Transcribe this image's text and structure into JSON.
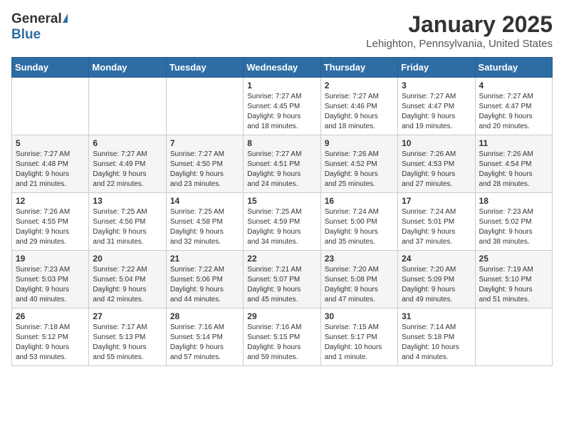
{
  "header": {
    "logo_general": "General",
    "logo_blue": "Blue",
    "month_title": "January 2025",
    "location": "Lehighton, Pennsylvania, United States"
  },
  "days_of_week": [
    "Sunday",
    "Monday",
    "Tuesday",
    "Wednesday",
    "Thursday",
    "Friday",
    "Saturday"
  ],
  "weeks": [
    [
      {
        "day": "",
        "info": ""
      },
      {
        "day": "",
        "info": ""
      },
      {
        "day": "",
        "info": ""
      },
      {
        "day": "1",
        "info": "Sunrise: 7:27 AM\nSunset: 4:45 PM\nDaylight: 9 hours\nand 18 minutes."
      },
      {
        "day": "2",
        "info": "Sunrise: 7:27 AM\nSunset: 4:46 PM\nDaylight: 9 hours\nand 18 minutes."
      },
      {
        "day": "3",
        "info": "Sunrise: 7:27 AM\nSunset: 4:47 PM\nDaylight: 9 hours\nand 19 minutes."
      },
      {
        "day": "4",
        "info": "Sunrise: 7:27 AM\nSunset: 4:47 PM\nDaylight: 9 hours\nand 20 minutes."
      }
    ],
    [
      {
        "day": "5",
        "info": "Sunrise: 7:27 AM\nSunset: 4:48 PM\nDaylight: 9 hours\nand 21 minutes."
      },
      {
        "day": "6",
        "info": "Sunrise: 7:27 AM\nSunset: 4:49 PM\nDaylight: 9 hours\nand 22 minutes."
      },
      {
        "day": "7",
        "info": "Sunrise: 7:27 AM\nSunset: 4:50 PM\nDaylight: 9 hours\nand 23 minutes."
      },
      {
        "day": "8",
        "info": "Sunrise: 7:27 AM\nSunset: 4:51 PM\nDaylight: 9 hours\nand 24 minutes."
      },
      {
        "day": "9",
        "info": "Sunrise: 7:26 AM\nSunset: 4:52 PM\nDaylight: 9 hours\nand 25 minutes."
      },
      {
        "day": "10",
        "info": "Sunrise: 7:26 AM\nSunset: 4:53 PM\nDaylight: 9 hours\nand 27 minutes."
      },
      {
        "day": "11",
        "info": "Sunrise: 7:26 AM\nSunset: 4:54 PM\nDaylight: 9 hours\nand 28 minutes."
      }
    ],
    [
      {
        "day": "12",
        "info": "Sunrise: 7:26 AM\nSunset: 4:55 PM\nDaylight: 9 hours\nand 29 minutes."
      },
      {
        "day": "13",
        "info": "Sunrise: 7:25 AM\nSunset: 4:56 PM\nDaylight: 9 hours\nand 31 minutes."
      },
      {
        "day": "14",
        "info": "Sunrise: 7:25 AM\nSunset: 4:58 PM\nDaylight: 9 hours\nand 32 minutes."
      },
      {
        "day": "15",
        "info": "Sunrise: 7:25 AM\nSunset: 4:59 PM\nDaylight: 9 hours\nand 34 minutes."
      },
      {
        "day": "16",
        "info": "Sunrise: 7:24 AM\nSunset: 5:00 PM\nDaylight: 9 hours\nand 35 minutes."
      },
      {
        "day": "17",
        "info": "Sunrise: 7:24 AM\nSunset: 5:01 PM\nDaylight: 9 hours\nand 37 minutes."
      },
      {
        "day": "18",
        "info": "Sunrise: 7:23 AM\nSunset: 5:02 PM\nDaylight: 9 hours\nand 38 minutes."
      }
    ],
    [
      {
        "day": "19",
        "info": "Sunrise: 7:23 AM\nSunset: 5:03 PM\nDaylight: 9 hours\nand 40 minutes."
      },
      {
        "day": "20",
        "info": "Sunrise: 7:22 AM\nSunset: 5:04 PM\nDaylight: 9 hours\nand 42 minutes."
      },
      {
        "day": "21",
        "info": "Sunrise: 7:22 AM\nSunset: 5:06 PM\nDaylight: 9 hours\nand 44 minutes."
      },
      {
        "day": "22",
        "info": "Sunrise: 7:21 AM\nSunset: 5:07 PM\nDaylight: 9 hours\nand 45 minutes."
      },
      {
        "day": "23",
        "info": "Sunrise: 7:20 AM\nSunset: 5:08 PM\nDaylight: 9 hours\nand 47 minutes."
      },
      {
        "day": "24",
        "info": "Sunrise: 7:20 AM\nSunset: 5:09 PM\nDaylight: 9 hours\nand 49 minutes."
      },
      {
        "day": "25",
        "info": "Sunrise: 7:19 AM\nSunset: 5:10 PM\nDaylight: 9 hours\nand 51 minutes."
      }
    ],
    [
      {
        "day": "26",
        "info": "Sunrise: 7:18 AM\nSunset: 5:12 PM\nDaylight: 9 hours\nand 53 minutes."
      },
      {
        "day": "27",
        "info": "Sunrise: 7:17 AM\nSunset: 5:13 PM\nDaylight: 9 hours\nand 55 minutes."
      },
      {
        "day": "28",
        "info": "Sunrise: 7:16 AM\nSunset: 5:14 PM\nDaylight: 9 hours\nand 57 minutes."
      },
      {
        "day": "29",
        "info": "Sunrise: 7:16 AM\nSunset: 5:15 PM\nDaylight: 9 hours\nand 59 minutes."
      },
      {
        "day": "30",
        "info": "Sunrise: 7:15 AM\nSunset: 5:17 PM\nDaylight: 10 hours\nand 1 minute."
      },
      {
        "day": "31",
        "info": "Sunrise: 7:14 AM\nSunset: 5:18 PM\nDaylight: 10 hours\nand 4 minutes."
      },
      {
        "day": "",
        "info": ""
      }
    ]
  ]
}
